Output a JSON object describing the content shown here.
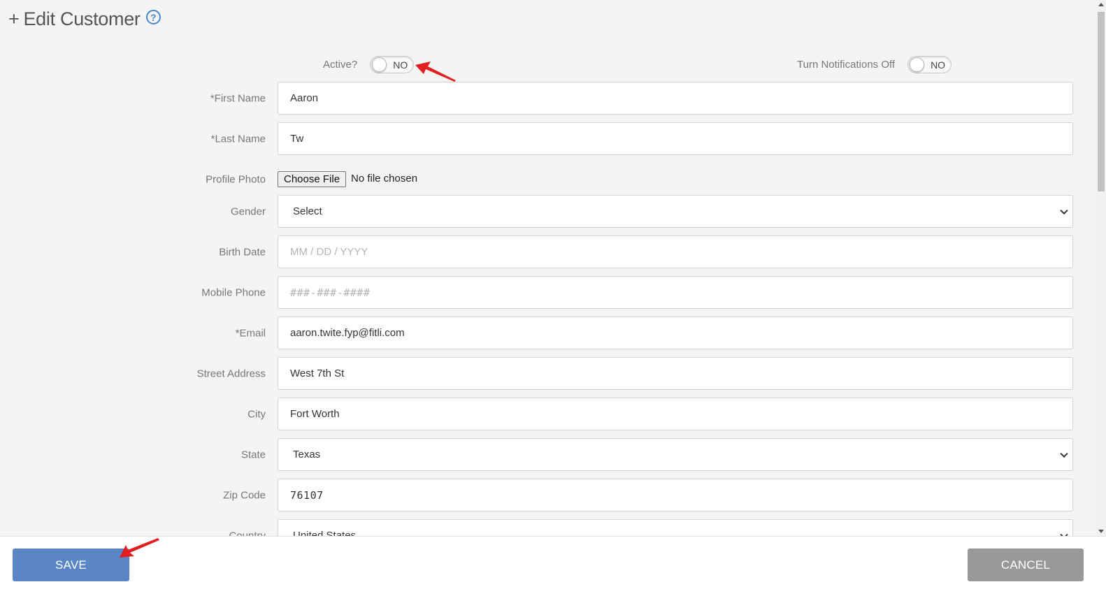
{
  "page": {
    "title_prefix": "+",
    "title": "Edit Customer",
    "help_icon_glyph": "?"
  },
  "toggles": {
    "active": {
      "label": "Active?",
      "state": "NO"
    },
    "notifications": {
      "label": "Turn Notifications Off",
      "state": "NO"
    }
  },
  "form": {
    "first_name": {
      "label": "*First Name",
      "value": "Aaron"
    },
    "last_name": {
      "label": "*Last Name",
      "value": "Tw"
    },
    "profile_photo": {
      "label": "Profile Photo",
      "button": "Choose File",
      "status": "No file chosen"
    },
    "gender": {
      "label": "Gender",
      "value": "Select"
    },
    "birth_date": {
      "label": "Birth Date",
      "placeholder": "MM / DD / YYYY"
    },
    "mobile_phone": {
      "label": "Mobile Phone",
      "placeholder": "###-###-####"
    },
    "email": {
      "label": "*Email",
      "value": "aaron.twite.fyp@fitli.com"
    },
    "street_address": {
      "label": "Street Address",
      "value": "West 7th St"
    },
    "city": {
      "label": "City",
      "value": "Fort Worth"
    },
    "state": {
      "label": "State",
      "value": "Texas"
    },
    "zip_code": {
      "label": "Zip Code",
      "value": "76107"
    },
    "country": {
      "label": "Country",
      "value": "United States"
    }
  },
  "footer": {
    "save_label": "SAVE",
    "cancel_label": "CANCEL"
  },
  "colors": {
    "save_button": "#5a85c6",
    "cancel_button": "#999999",
    "annotation_arrow": "#e02020",
    "help_icon": "#4a86c8"
  }
}
